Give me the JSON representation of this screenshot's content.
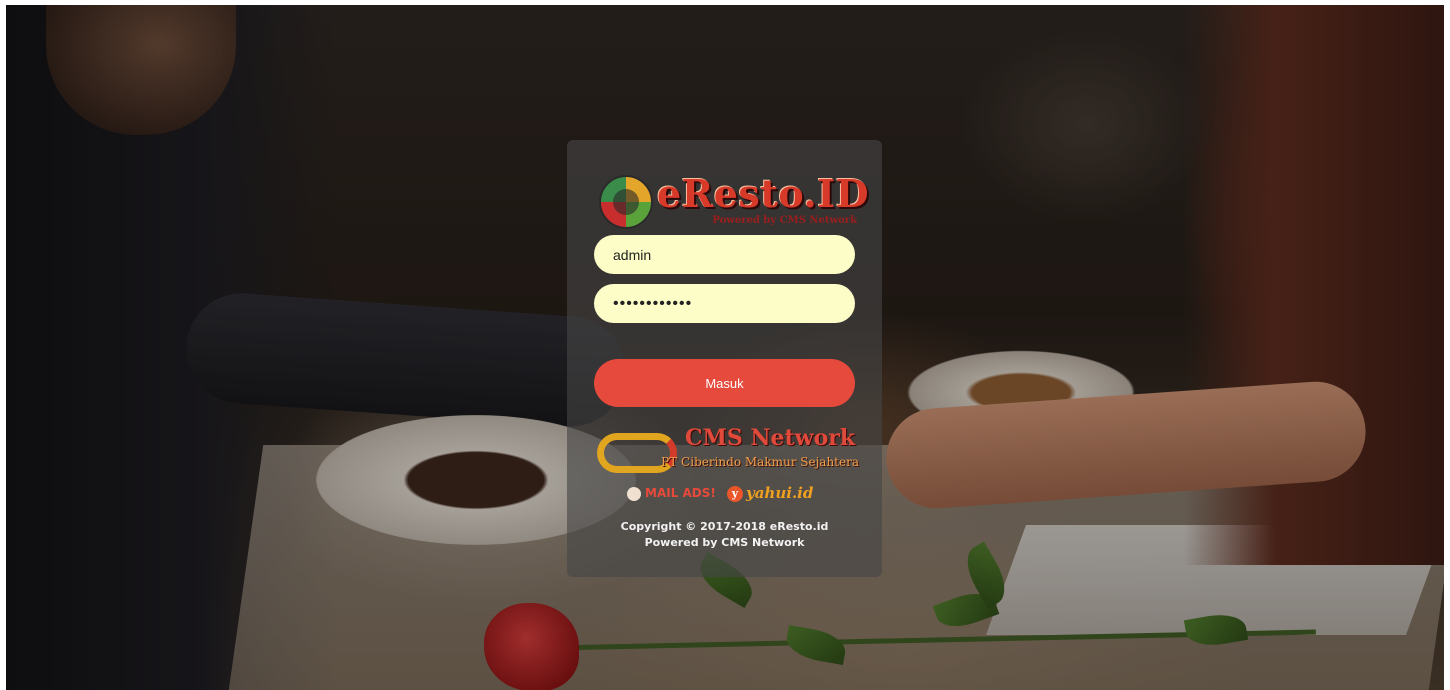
{
  "app": {
    "logo_text": "eResto.ID",
    "logo_tagline": "Powered by CMS Network"
  },
  "login": {
    "username_value": "admin",
    "password_value": "••••••••••••",
    "submit_label": "Masuk"
  },
  "sponsor": {
    "cms_title": "CMS Network",
    "cms_company": "PT Ciberindo Makmur Sejahtera",
    "partner_1": "MAIL ADS!",
    "partner_2": "yahui.id"
  },
  "footer": {
    "copyright_prefix": "Copyright © 2017-2018 ",
    "copyright_brand": "eResto.id",
    "powered_prefix": "Powered by ",
    "powered_brand": "CMS Network"
  },
  "colors": {
    "button": "#e54a3d",
    "input_bg": "#fdfdc8",
    "card_bg": "rgba(70,70,70,0.62)"
  }
}
